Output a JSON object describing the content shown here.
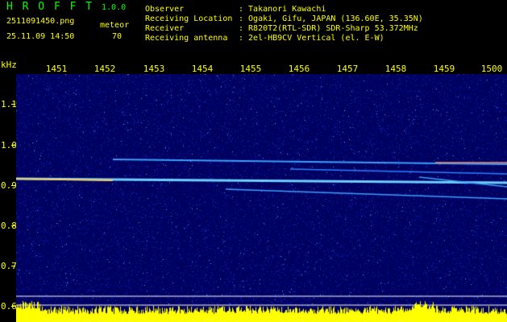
{
  "app": {
    "name": "H R O F F T",
    "version": "1.0.0"
  },
  "file": {
    "name": "2511091450.png",
    "datetime": "25.11.09 14:50"
  },
  "detector": {
    "label": "meteor",
    "count": "70"
  },
  "info": {
    "observer_label": "Observer",
    "observer_value": ": Takanori Kawachi",
    "location_label": "Receiving Location",
    "location_value": ": Ogaki, Gifu, JAPAN (136.60E, 35.35N)",
    "receiver_label": "Receiver",
    "receiver_value": ": R820T2(RTL-SDR) SDR-Sharp 53.372MHz",
    "antenna_label": "Receiving antenna",
    "antenna_value": ": 2el-HB9CV Vertical (el. E-W)"
  },
  "axes": {
    "y_unit": "kHz",
    "x_ticks": [
      "1451",
      "1452",
      "1453",
      "1454",
      "1455",
      "1456",
      "1457",
      "1458",
      "1459",
      "1500"
    ],
    "y_ticks": [
      "1.1",
      "1.0",
      "0.9",
      "0.8",
      "0.7",
      "0.6"
    ]
  },
  "colors": {
    "header_green": "#00ff00",
    "axis_yellow": "#ffff00",
    "background": "#000000",
    "noise": "#000078"
  }
}
